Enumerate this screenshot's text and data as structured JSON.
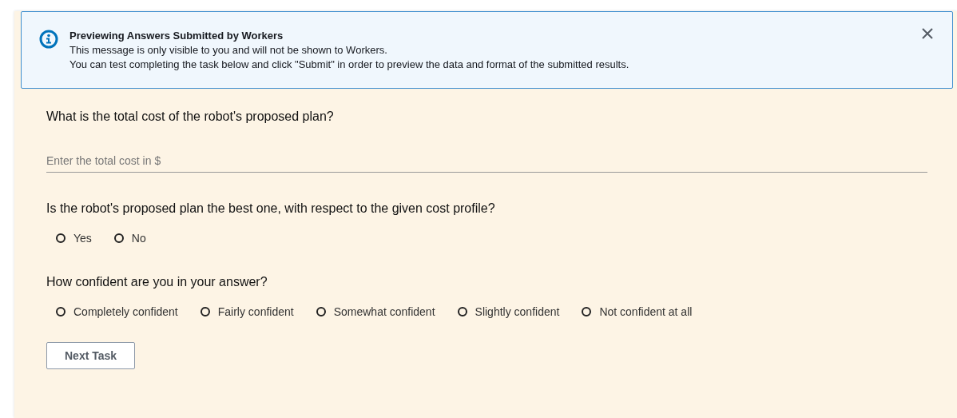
{
  "alert": {
    "title": "Previewing Answers Submitted by Workers",
    "lines": [
      "This message is only visible to you and will not be shown to Workers.",
      "You can test completing the task below and click \"Submit\" in order to preview the data and format of the submitted results."
    ]
  },
  "questions": [
    {
      "kind": "text",
      "prompt": "What is the total cost of the robot's proposed plan?",
      "placeholder": "Enter the total cost in $"
    },
    {
      "kind": "radio",
      "prompt": "Is the robot's proposed plan the best one, with respect to the given cost profile?",
      "options": [
        {
          "label": "Yes",
          "selected": false
        },
        {
          "label": "No",
          "selected": false
        }
      ]
    },
    {
      "kind": "radio",
      "prompt": "How confident are you in your answer?",
      "options": [
        {
          "label": "Completely confident",
          "selected": false
        },
        {
          "label": "Fairly confident",
          "selected": false
        },
        {
          "label": "Somewhat confident",
          "selected": false
        },
        {
          "label": "Slightly confident",
          "selected": false
        },
        {
          "label": "Not confident at all",
          "selected": false
        }
      ]
    }
  ],
  "button": "Next Task"
}
